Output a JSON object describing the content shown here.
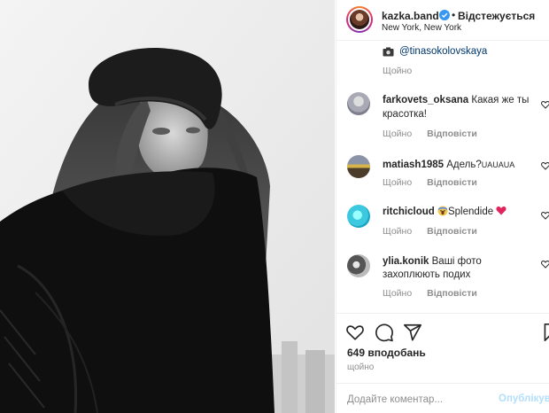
{
  "header": {
    "username": "kazka.band",
    "separator": "•",
    "follow_status": "Відстежується",
    "location": "New York, New York"
  },
  "comments": [
    {
      "mention": "@tinasokolovskaya",
      "time": "Щойно"
    },
    {
      "username": "farkovets_oksana",
      "text_line1": "Какая же ты",
      "text_line2": "красотка!",
      "time": "Щойно",
      "reply": "Відповісти"
    },
    {
      "username": "matiash1985",
      "text": "Адель?",
      "text_small": "UAUAUA",
      "time": "Щойно",
      "reply": "Відповісти"
    },
    {
      "username": "ritchicloud",
      "text": "Splendide",
      "time": "Щойно",
      "reply": "Відповісти"
    },
    {
      "username": "ylia.konik",
      "text_line1": "Ваші фото",
      "text_line2": "захоплюють подих",
      "time": "Щойно",
      "reply": "Відповісти"
    }
  ],
  "actions": {
    "likes": "649 вподобань",
    "time": "щойно"
  },
  "add_comment": {
    "placeholder": "Додайте коментар...",
    "publish": "Опублікувати"
  },
  "colors": {
    "accent": "#0095f6",
    "publish_disabled": "#b2dffc",
    "heart": "#ed4956"
  }
}
